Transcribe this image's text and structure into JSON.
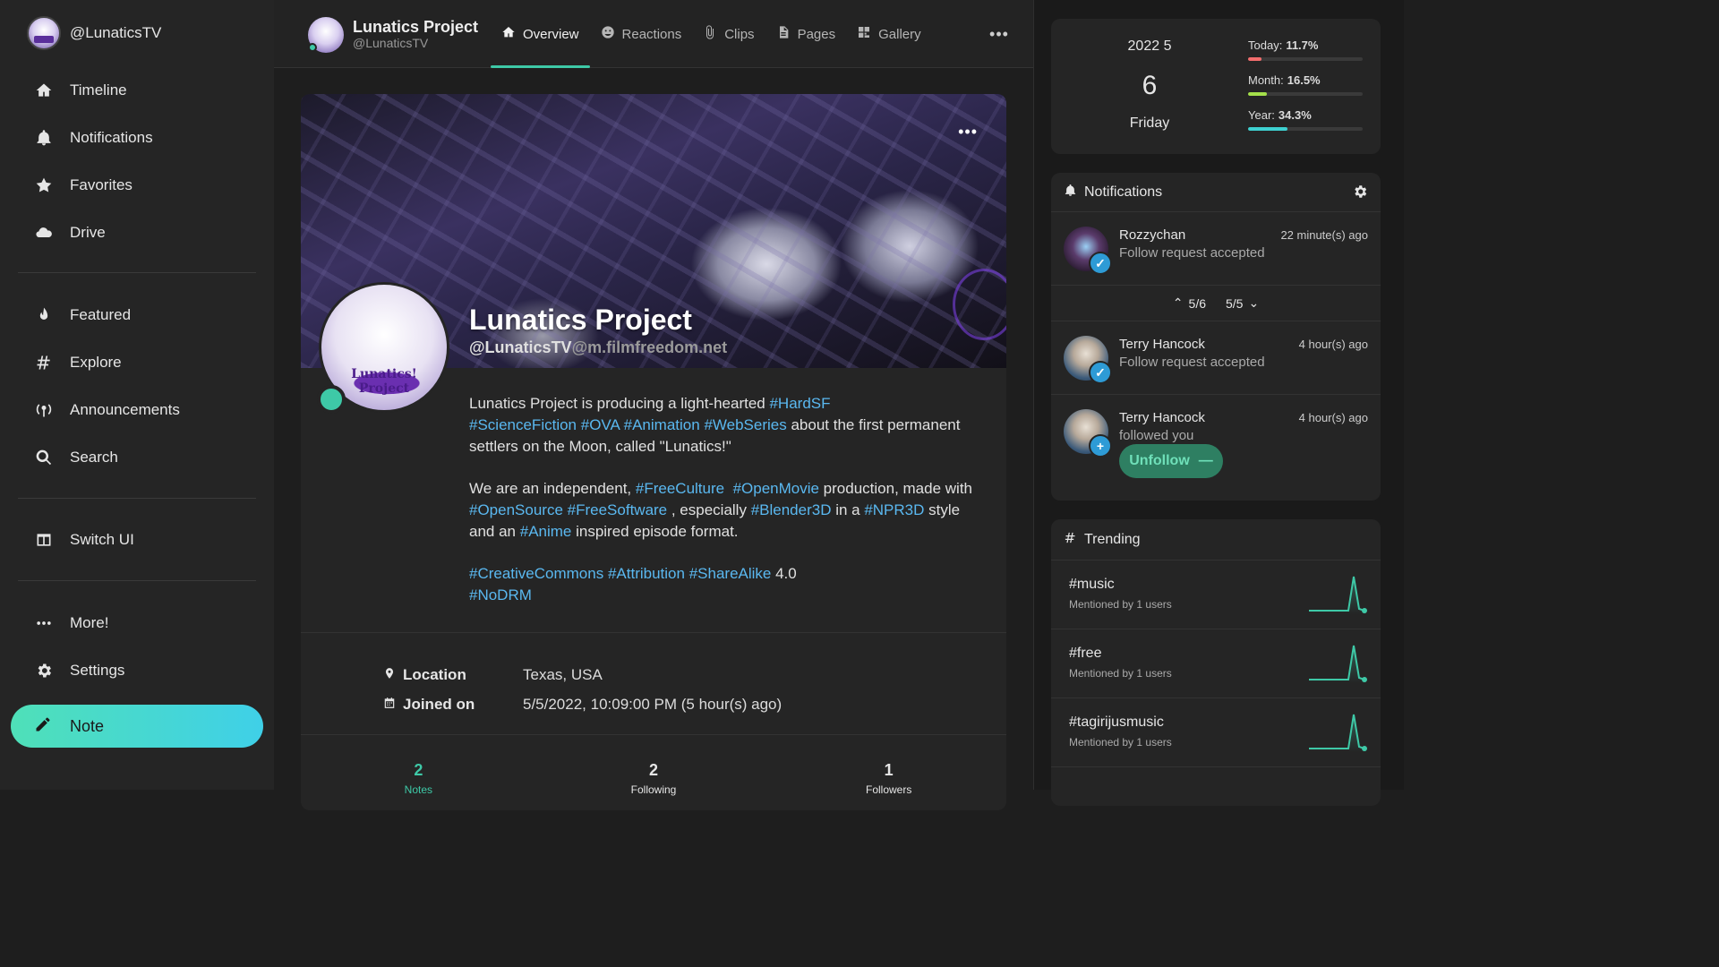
{
  "sidebar": {
    "account": "@LunaticsTV",
    "items": [
      {
        "label": "Timeline",
        "icon": "home-icon"
      },
      {
        "label": "Notifications",
        "icon": "bell-icon"
      },
      {
        "label": "Favorites",
        "icon": "star-icon"
      },
      {
        "label": "Drive",
        "icon": "cloud-icon"
      },
      {
        "label": "Featured",
        "icon": "fire-icon"
      },
      {
        "label": "Explore",
        "icon": "hashtag-icon"
      },
      {
        "label": "Announcements",
        "icon": "broadcast-icon"
      },
      {
        "label": "Search",
        "icon": "search-icon"
      },
      {
        "label": "Switch UI",
        "icon": "columns-icon"
      },
      {
        "label": "More!",
        "icon": "ellipsis-icon"
      },
      {
        "label": "Settings",
        "icon": "gear-icon"
      }
    ],
    "note_label": "Note"
  },
  "header": {
    "name": "Lunatics Project",
    "handle": "@LunaticsTV",
    "tabs": [
      {
        "label": "Overview",
        "icon": "home-icon",
        "active": true
      },
      {
        "label": "Reactions",
        "icon": "smile-icon"
      },
      {
        "label": "Clips",
        "icon": "paperclip-icon"
      },
      {
        "label": "Pages",
        "icon": "file-icon"
      },
      {
        "label": "Gallery",
        "icon": "image-icon"
      }
    ]
  },
  "profile": {
    "name": "Lunatics Project",
    "handle": "@LunaticsTV",
    "host": "@m.filmfreedom.net",
    "avatar_text": "Lunatics! Project",
    "bio": {
      "p1_text1": "Lunatics Project is producing a light-hearted ",
      "p1_tag1": "#HardSF",
      "p1_tag2": "#ScienceFiction",
      "p1_tag3": "#OVA",
      "p1_tag4": "#Animation",
      "p1_tag5": "#WebSeries",
      "p1_text2": " about the first permanent settlers on the Moon, called \"Lunatics!\"",
      "p2_text1": "We are an independent, ",
      "p2_tag1": "#FreeCulture",
      "p2_tag2": "#OpenMovie",
      "p2_text2": " production, made with ",
      "p2_tag3": "#OpenSource",
      "p2_tag4": "#FreeSoftware",
      "p2_text3": " , especially ",
      "p2_tag5": "#Blender3D",
      "p2_text4": " in a ",
      "p2_tag6": "#NPR3D",
      "p2_text5": " style and an ",
      "p2_tag7": "#Anime",
      "p2_text6": " inspired episode format.",
      "p3_tag1": "#CreativeCommons",
      "p3_tag2": "#Attribution",
      "p3_tag3": "#ShareAlike",
      "p3_text1": " 4.0",
      "p3_tag4": "#NoDRM"
    },
    "location_label": "Location",
    "location": "Texas, USA",
    "joined_label": "Joined on",
    "joined": "5/5/2022, 10:09:00 PM (5 hour(s) ago)",
    "counts": [
      {
        "value": "2",
        "label": "Notes"
      },
      {
        "value": "2",
        "label": "Following"
      },
      {
        "value": "1",
        "label": "Followers"
      }
    ]
  },
  "calendar": {
    "year_month": "2022  5",
    "day": "6",
    "weekday": "Friday",
    "stats": [
      {
        "label": "Today:",
        "value": "11.7%",
        "fraction": 0.117,
        "color": "#f26d6d"
      },
      {
        "label": "Month:",
        "value": "16.5%",
        "fraction": 0.165,
        "color": "#a4e04a"
      },
      {
        "label": "Year:",
        "value": "34.3%",
        "fraction": 0.343,
        "color": "#3ed1d1"
      }
    ]
  },
  "notifications": {
    "title": "Notifications",
    "items": [
      {
        "name": "Rozzychan",
        "text": "Follow request accepted",
        "time": "22 minute(s) ago",
        "badge": "✓",
        "badge_color": "#2e9bd6"
      },
      {
        "name": "Terry Hancock",
        "text": "Follow request accepted",
        "time": "4 hour(s) ago",
        "badge": "✓",
        "badge_color": "#2e9bd6"
      },
      {
        "name": "Terry Hancock",
        "text": "followed you",
        "time": "4 hour(s) ago",
        "badge": "+",
        "badge_color": "#2e9bd6"
      }
    ],
    "pager_left": "5/6",
    "pager_right": "5/5",
    "unfollow_label": "Unfollow"
  },
  "trending": {
    "title": "Trending",
    "items": [
      {
        "tag": "#music",
        "sub": "Mentioned by 1 users"
      },
      {
        "tag": "#free",
        "sub": "Mentioned by 1 users"
      },
      {
        "tag": "#tagirijusmusic",
        "sub": "Mentioned by 1 users"
      }
    ]
  }
}
